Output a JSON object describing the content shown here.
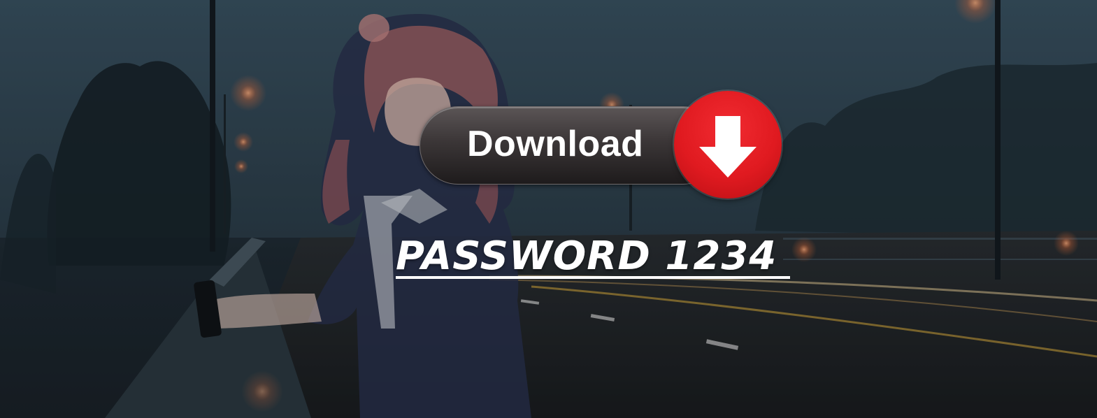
{
  "download_button": {
    "label": "Download",
    "icon": "arrow-down-icon",
    "accent_color": "#e01a20"
  },
  "password": {
    "text": "PASSWORD 1234"
  },
  "background": {
    "description_icon": "night-road-scene"
  }
}
